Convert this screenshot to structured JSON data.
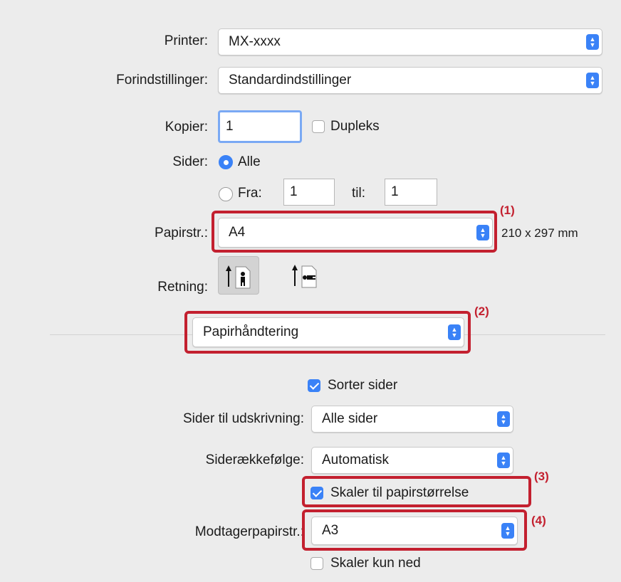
{
  "printer": {
    "label": "Printer:",
    "value": "MX-xxxx"
  },
  "presets": {
    "label": "Forindstillinger:",
    "value": "Standardindstillinger"
  },
  "copies": {
    "label": "Kopier:",
    "value": "1",
    "duplex_label": "Dupleks",
    "duplex_checked": false
  },
  "pages": {
    "label": "Sider:",
    "all_label": "Alle",
    "all_selected": true,
    "from_label": "Fra:",
    "from_value": "1",
    "to_label": "til:",
    "to_value": "1"
  },
  "paper_size": {
    "label": "Papirstr.:",
    "value": "A4",
    "dimensions": "210 x 297 mm"
  },
  "orientation": {
    "label": "Retning:",
    "options": [
      "portrait-icon",
      "landscape-icon"
    ],
    "selected": "portrait"
  },
  "section_menu": {
    "value": "Papirhåndtering"
  },
  "collate": {
    "label": "Sorter sider",
    "checked": true
  },
  "pages_to_print": {
    "label": "Sider til udskrivning:",
    "value": "Alle sider"
  },
  "page_order": {
    "label": "Siderækkefølge:",
    "value": "Automatisk"
  },
  "scale_to_paper": {
    "label": "Skaler til papirstørrelse",
    "checked": true
  },
  "destination_paper": {
    "label": "Modtagerpapirstr.:",
    "value": "A3"
  },
  "scale_down_only": {
    "label": "Skaler kun ned",
    "checked": false
  },
  "callouts": [
    "(1)",
    "(2)",
    "(3)",
    "(4)"
  ],
  "colors": {
    "accent": "#3a82f7",
    "highlight": "#c3202f",
    "background": "#ececec"
  }
}
